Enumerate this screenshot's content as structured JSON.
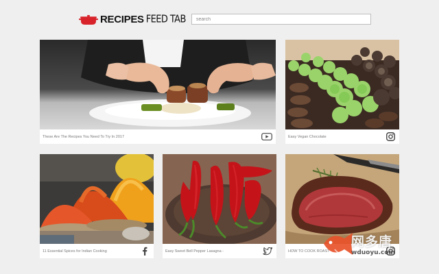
{
  "header": {
    "brand_bold": "RECIPES",
    "brand_light": "FEED TAB",
    "logo_icon": "cooking-pot-icon",
    "brand_color": "#d8232a",
    "search_placeholder": "search"
  },
  "cards": [
    {
      "caption": "These Are The Recipes You Need To Try In 2017",
      "source_icon": "youtube-icon"
    },
    {
      "caption": "Easy Vegan Chocolate",
      "source_icon": "instagram-icon"
    },
    {
      "caption": "11 Essential Spices for Indian Cooking",
      "source_icon": "facebook-icon"
    },
    {
      "caption": "Easy Sweet Bell Pepper Lasagna -",
      "source_icon": "twitter-icon"
    },
    {
      "caption": "HOW TO COOK ROAST",
      "source_icon": "instagram-icon"
    }
  ],
  "watermark": {
    "text": "网多唐",
    "url": "wduoyu.com"
  }
}
